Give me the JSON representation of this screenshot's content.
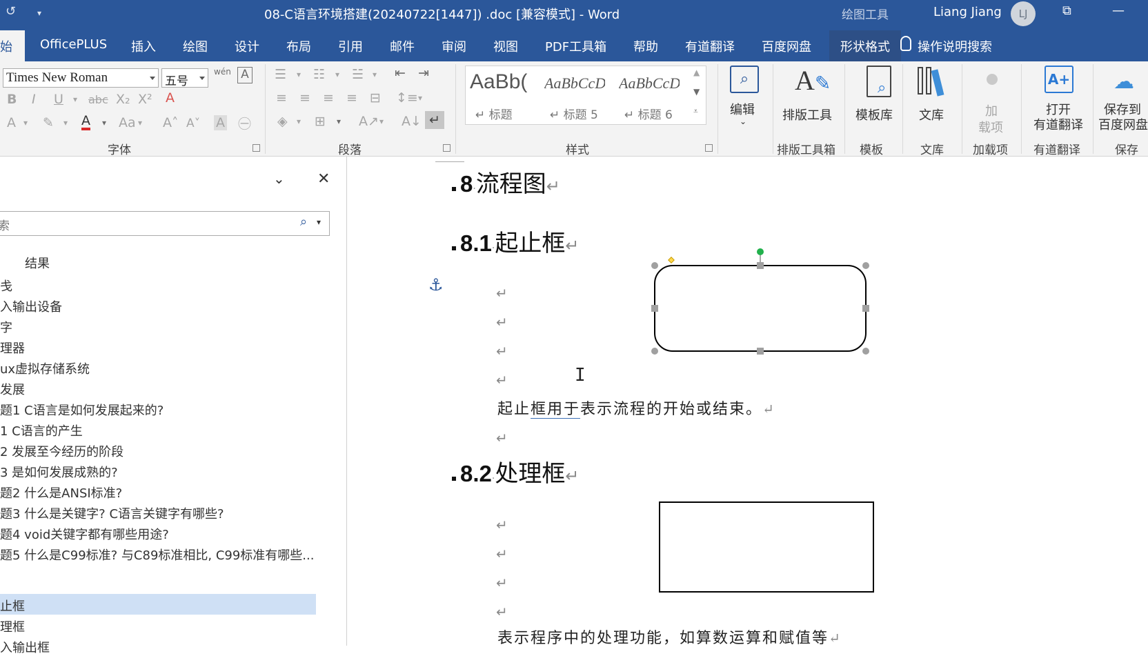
{
  "titlebar": {
    "title": "08-C语言环境搭建(20240722[1447]) .doc [兼容模式]  -  Word",
    "contextual": "绘图工具",
    "user": "Liang Jiang",
    "avatar": "LJ",
    "icons": [
      "undo-icon",
      "customize-qat-icon",
      "ribbon-display-icon",
      "minimize-icon"
    ]
  },
  "tabs": {
    "home": "始",
    "officeplus": "OfficePLUS",
    "insert": "插入",
    "draw": "绘图",
    "design": "设计",
    "layout": "布局",
    "references": "引用",
    "mailings": "邮件",
    "review": "审阅",
    "view": "视图",
    "pdf": "PDF工具箱",
    "help": "帮助",
    "youdao": "有道翻译",
    "baidu": "百度网盘",
    "shape_format": "形状格式",
    "tell_me": "操作说明搜索"
  },
  "ribbon": {
    "font_name": "Times New Roman",
    "font_size": "五号",
    "phonetic": "wén",
    "groups": {
      "font": "字体",
      "paragraph": "段落",
      "styles": "样式",
      "typeset": "排版工具箱",
      "template": "模板",
      "library": "文库",
      "addins": "加载项",
      "youdao": "有道翻译",
      "save": "保存"
    },
    "styles": [
      {
        "preview": "AaBb(",
        "name": "↵ 标题"
      },
      {
        "preview": "AaBbCcDd",
        "name": "↵ 标题 5"
      },
      {
        "preview": "AaBbCcDd",
        "name": "↵ 标题 6"
      }
    ],
    "buttons": {
      "edit": "编辑",
      "typeset": "排版工具",
      "template": "模板库",
      "library": "文库",
      "addin_1": "加",
      "addin_2": "载项",
      "open_youdao_1": "打开",
      "open_youdao_2": "有道翻译",
      "save_baidu_1": "保存到",
      "save_baidu_2": "百度网盘"
    }
  },
  "nav": {
    "search_placeholder": "索",
    "results_tab": "结果",
    "items": [
      "戋",
      "入输出设备",
      "字",
      "理器",
      "ux虚拟存储系统",
      "发展",
      "题1 C语言是如何发展起来的?",
      "1 C语言的产生",
      "2 发展至今经历的阶段",
      "3 是如何发展成熟的?",
      "题2 什么是ANSI标准?",
      "题3 什么是关键字? C语言关键字有哪些?",
      "题4 void关键字都有哪些用途?",
      "题5 什么是C99标准? 与C89标准相比, C99标准有哪些...",
      "止框",
      "理框",
      "入输出框"
    ]
  },
  "doc": {
    "h8_num": "8",
    "h8_text": "流程图",
    "h81_num": "8.1",
    "h81_text": "起止框",
    "terminator_text_a": "起止",
    "terminator_text_u": "框用于",
    "terminator_text_b": "表示流程的开始或结束。",
    "h82_num": "8.2",
    "h82_text": "处理框",
    "process_text": "表示程序中的处理功能，如算数运算和赋值等",
    "para_mark": "↵",
    "anchor": "⚓"
  }
}
